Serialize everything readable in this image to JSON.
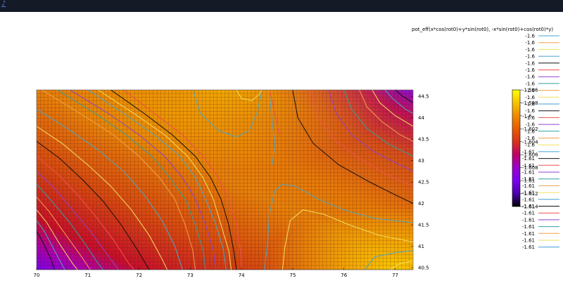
{
  "window": {
    "menu_icon": "menu-icon"
  },
  "colors": {
    "topbar": "#151a27",
    "colormap": [
      "#000000",
      "#4a00a8",
      "#7a00f0",
      "#9a00c8",
      "#c0006a",
      "#d8301a",
      "#e85c00",
      "#f08a00",
      "#f8c200",
      "#ffff00"
    ]
  },
  "chart_data": {
    "type": "heatmap",
    "title": "",
    "xlabel": "",
    "ylabel": "",
    "xlim": [
      70,
      77.35
    ],
    "ylim": [
      40.45,
      44.65
    ],
    "xticks": [
      "70",
      "71",
      "72",
      "73",
      "74",
      "75",
      "76",
      "77"
    ],
    "yticks": [
      "40.5",
      "41",
      "41.5",
      "42",
      "42.5",
      "43",
      "43.5",
      "44",
      "44.5"
    ],
    "grid": true,
    "legend_position": "top-right",
    "legend": {
      "title": "pot_eff(x*cos(rot0)+y*sin(rot0), -x*sin(rot0)+cos(rot0)*y)",
      "entries": [
        {
          "label": "-1.6",
          "color": "#4aa8c8"
        },
        {
          "label": "-1.6",
          "color": "#f0a050"
        },
        {
          "label": "-1.6",
          "color": "#f0e060"
        },
        {
          "label": "-1.6",
          "color": "#40a0d0"
        },
        {
          "label": "-1.6",
          "color": "#101010"
        },
        {
          "label": "-1.6",
          "color": "#f05050"
        },
        {
          "label": "-1.6",
          "color": "#9040d0"
        },
        {
          "label": "-1.6",
          "color": "#30a0a0"
        },
        {
          "label": "-1.6",
          "color": "#f0a050"
        },
        {
          "label": "-1.6",
          "color": "#f0e060"
        },
        {
          "label": "-1.6",
          "color": "#40a0d0"
        },
        {
          "label": "-1.6",
          "color": "#101010"
        },
        {
          "label": "-1.6",
          "color": "#f05050"
        },
        {
          "label": "-1.6",
          "color": "#9040d0"
        },
        {
          "label": "-1.6",
          "color": "#30a0a0"
        },
        {
          "label": "-1.6",
          "color": "#f0a050"
        },
        {
          "label": "-1.6",
          "color": "#f0e060"
        },
        {
          "label": "-1.61",
          "color": "#40a0d0"
        },
        {
          "label": "-1.61",
          "color": "#101010"
        },
        {
          "label": "-1.61",
          "color": "#f05050"
        },
        {
          "label": "-1.61",
          "color": "#9040d0"
        },
        {
          "label": "-1.61",
          "color": "#30a0a0"
        },
        {
          "label": "-1.61",
          "color": "#f0a050"
        },
        {
          "label": "-1.61",
          "color": "#f0e060"
        },
        {
          "label": "-1.61",
          "color": "#40a0d0"
        },
        {
          "label": "-1.61",
          "color": "#101010"
        },
        {
          "label": "-1.61",
          "color": "#f05050"
        },
        {
          "label": "-1.61",
          "color": "#9040d0"
        },
        {
          "label": "-1.61",
          "color": "#30a0a0"
        },
        {
          "label": "-1.61",
          "color": "#f0a050"
        },
        {
          "label": "-1.61",
          "color": "#f0e060"
        },
        {
          "label": "-1.61",
          "color": "#40a0d0"
        }
      ]
    },
    "colorbar": {
      "range": [
        -1.614,
        -1.596
      ],
      "labels": [
        "-1.596",
        "-1.598",
        "-1.6",
        "-1.602",
        "-1.604",
        "-1.606",
        "-1.608",
        "-1.61",
        "-1.612",
        "-1.614"
      ]
    },
    "contours": [
      {
        "color": "#4aa8c8",
        "points": [
          [
            71.0,
            44.65
          ],
          [
            71.7,
            44.1
          ],
          [
            72.3,
            43.6
          ],
          [
            72.8,
            43.1
          ],
          [
            73.1,
            42.6
          ],
          [
            73.3,
            42.1
          ],
          [
            73.5,
            41.5
          ],
          [
            73.65,
            40.9
          ],
          [
            73.7,
            40.45
          ]
        ]
      },
      {
        "color": "#f0e060",
        "points": [
          [
            71.2,
            44.65
          ],
          [
            71.9,
            44.1
          ],
          [
            72.5,
            43.6
          ],
          [
            72.95,
            43.1
          ],
          [
            73.25,
            42.6
          ],
          [
            73.45,
            42.1
          ],
          [
            73.6,
            41.5
          ],
          [
            73.75,
            40.9
          ],
          [
            73.8,
            40.45
          ]
        ]
      },
      {
        "color": "#101010",
        "points": [
          [
            71.45,
            44.65
          ],
          [
            72.1,
            44.1
          ],
          [
            72.65,
            43.6
          ],
          [
            73.1,
            43.1
          ],
          [
            73.4,
            42.6
          ],
          [
            73.6,
            42.1
          ],
          [
            73.75,
            41.5
          ],
          [
            73.85,
            40.9
          ],
          [
            73.9,
            40.45
          ]
        ]
      },
      {
        "color": "#f05050",
        "points": [
          [
            71.7,
            44.65
          ],
          [
            72.3,
            44.1
          ],
          [
            72.85,
            43.6
          ],
          [
            73.25,
            43.1
          ],
          [
            73.55,
            42.6
          ],
          [
            73.75,
            42.1
          ],
          [
            73.9,
            41.5
          ],
          [
            73.98,
            40.9
          ],
          [
            74.0,
            40.45
          ]
        ]
      },
      {
        "color": "#9040d0",
        "points": [
          [
            70.65,
            44.65
          ],
          [
            71.4,
            44.1
          ],
          [
            72.0,
            43.6
          ],
          [
            72.5,
            43.1
          ],
          [
            72.85,
            42.6
          ],
          [
            73.1,
            42.1
          ],
          [
            73.3,
            41.5
          ],
          [
            73.45,
            40.9
          ],
          [
            73.5,
            40.45
          ]
        ]
      },
      {
        "color": "#30a0a0",
        "points": [
          [
            70.4,
            44.65
          ],
          [
            71.15,
            44.1
          ],
          [
            71.75,
            43.6
          ],
          [
            72.25,
            43.1
          ],
          [
            72.6,
            42.6
          ],
          [
            72.9,
            42.1
          ],
          [
            73.1,
            41.5
          ],
          [
            73.25,
            40.9
          ],
          [
            73.3,
            40.45
          ]
        ]
      },
      {
        "color": "#f0a050",
        "points": [
          [
            70.1,
            44.65
          ],
          [
            70.85,
            44.1
          ],
          [
            71.5,
            43.6
          ],
          [
            72.0,
            43.1
          ],
          [
            72.4,
            42.6
          ],
          [
            72.7,
            42.1
          ],
          [
            72.9,
            41.5
          ],
          [
            73.05,
            40.9
          ],
          [
            73.1,
            40.45
          ]
        ]
      },
      {
        "color": "#4aa8c8",
        "points": [
          [
            70.0,
            44.2
          ],
          [
            70.6,
            43.75
          ],
          [
            71.2,
            43.25
          ],
          [
            71.7,
            42.75
          ],
          [
            72.1,
            42.2
          ],
          [
            72.45,
            41.6
          ],
          [
            72.7,
            41.0
          ],
          [
            72.85,
            40.45
          ]
        ]
      },
      {
        "color": "#f0e060",
        "points": [
          [
            70.0,
            43.8
          ],
          [
            70.5,
            43.4
          ],
          [
            71.0,
            42.9
          ],
          [
            71.45,
            42.4
          ],
          [
            71.85,
            41.85
          ],
          [
            72.2,
            41.25
          ],
          [
            72.45,
            40.7
          ],
          [
            72.55,
            40.45
          ]
        ]
      },
      {
        "color": "#101010",
        "points": [
          [
            70.0,
            43.45
          ],
          [
            70.45,
            43.05
          ],
          [
            70.9,
            42.55
          ],
          [
            71.3,
            42.05
          ],
          [
            71.65,
            41.5
          ],
          [
            71.95,
            40.95
          ],
          [
            72.2,
            40.45
          ]
        ]
      },
      {
        "color": "#f05050",
        "points": [
          [
            70.0,
            43.1
          ],
          [
            70.4,
            42.7
          ],
          [
            70.8,
            42.2
          ],
          [
            71.15,
            41.7
          ],
          [
            71.5,
            41.15
          ],
          [
            71.8,
            40.6
          ],
          [
            71.9,
            40.45
          ]
        ]
      },
      {
        "color": "#9040d0",
        "points": [
          [
            70.0,
            42.75
          ],
          [
            70.35,
            42.35
          ],
          [
            70.7,
            41.85
          ],
          [
            71.05,
            41.35
          ],
          [
            71.35,
            40.85
          ],
          [
            71.6,
            40.45
          ]
        ]
      },
      {
        "color": "#30a0a0",
        "points": [
          [
            70.0,
            42.45
          ],
          [
            70.3,
            42.05
          ],
          [
            70.65,
            41.55
          ],
          [
            70.95,
            41.05
          ],
          [
            71.2,
            40.6
          ],
          [
            71.3,
            40.45
          ]
        ]
      },
      {
        "color": "#f0a050",
        "points": [
          [
            70.0,
            42.15
          ],
          [
            70.25,
            41.8
          ],
          [
            70.55,
            41.3
          ],
          [
            70.85,
            40.8
          ],
          [
            71.05,
            40.45
          ]
        ]
      },
      {
        "color": "#f0e060",
        "points": [
          [
            70.0,
            41.85
          ],
          [
            70.2,
            41.55
          ],
          [
            70.45,
            41.05
          ],
          [
            70.7,
            40.6
          ],
          [
            70.8,
            40.45
          ]
        ]
      },
      {
        "color": "#4aa8c8",
        "points": [
          [
            70.0,
            41.6
          ],
          [
            70.15,
            41.35
          ],
          [
            70.35,
            40.9
          ],
          [
            70.55,
            40.45
          ]
        ]
      },
      {
        "color": "#101010",
        "points": [
          [
            70.0,
            41.35
          ],
          [
            70.12,
            41.1
          ],
          [
            70.28,
            40.7
          ],
          [
            70.35,
            40.45
          ]
        ]
      },
      {
        "color": "#4aa8c8",
        "points": [
          [
            73.05,
            44.65
          ],
          [
            73.2,
            44.1
          ],
          [
            73.55,
            43.7
          ],
          [
            73.9,
            43.55
          ],
          [
            74.15,
            43.7
          ],
          [
            74.3,
            44.1
          ],
          [
            74.4,
            44.65
          ]
        ]
      },
      {
        "color": "#f0e060",
        "points": [
          [
            73.9,
            44.65
          ],
          [
            74.0,
            44.45
          ],
          [
            74.2,
            44.4
          ],
          [
            74.35,
            44.55
          ],
          [
            74.4,
            44.65
          ]
        ]
      },
      {
        "color": "#f05050",
        "points": [
          [
            74.55,
            44.65
          ],
          [
            74.65,
            44.1
          ],
          [
            74.75,
            43.55
          ]
        ]
      },
      {
        "color": "#4aa8c8",
        "points": [
          [
            74.45,
            40.45
          ],
          [
            74.5,
            41.0
          ],
          [
            74.55,
            41.8
          ],
          [
            74.65,
            42.3
          ],
          [
            74.8,
            42.45
          ],
          [
            75.05,
            42.4
          ],
          [
            75.5,
            42.1
          ],
          [
            76.0,
            41.85
          ],
          [
            76.6,
            41.65
          ],
          [
            77.35,
            41.55
          ]
        ]
      },
      {
        "color": "#f0e060",
        "points": [
          [
            74.8,
            40.45
          ],
          [
            74.85,
            41.0
          ],
          [
            74.95,
            41.6
          ],
          [
            75.2,
            41.85
          ],
          [
            75.6,
            41.75
          ],
          [
            76.1,
            41.5
          ],
          [
            76.7,
            41.25
          ],
          [
            77.35,
            41.1
          ]
        ]
      },
      {
        "color": "#4aa8c8",
        "points": [
          [
            76.4,
            40.45
          ],
          [
            76.6,
            40.75
          ],
          [
            77.0,
            40.85
          ],
          [
            77.35,
            40.9
          ]
        ]
      },
      {
        "color": "#f0e060",
        "points": [
          [
            76.9,
            40.45
          ],
          [
            77.1,
            40.6
          ],
          [
            77.35,
            40.65
          ]
        ]
      },
      {
        "color": "#4aa8c8",
        "points": [
          [
            74.55,
            44.5
          ],
          [
            74.6,
            43.9
          ],
          [
            74.65,
            43.4
          ],
          [
            74.6,
            42.9
          ]
        ]
      },
      {
        "color": "#101010",
        "points": [
          [
            75.0,
            44.65
          ],
          [
            75.1,
            44.0
          ],
          [
            75.4,
            43.4
          ],
          [
            75.9,
            42.9
          ],
          [
            76.5,
            42.5
          ],
          [
            77.0,
            42.2
          ],
          [
            77.35,
            42.0
          ]
        ]
      },
      {
        "color": "#f05050",
        "points": [
          [
            75.35,
            44.65
          ],
          [
            75.5,
            44.0
          ],
          [
            75.85,
            43.45
          ],
          [
            76.3,
            43.05
          ],
          [
            76.8,
            42.7
          ],
          [
            77.35,
            42.4
          ]
        ]
      },
      {
        "color": "#9040d0",
        "points": [
          [
            75.7,
            44.65
          ],
          [
            75.85,
            44.1
          ],
          [
            76.15,
            43.6
          ],
          [
            76.6,
            43.2
          ],
          [
            77.0,
            42.95
          ],
          [
            77.35,
            42.75
          ]
        ]
      },
      {
        "color": "#30a0a0",
        "points": [
          [
            76.0,
            44.65
          ],
          [
            76.15,
            44.2
          ],
          [
            76.45,
            43.75
          ],
          [
            76.85,
            43.4
          ],
          [
            77.35,
            43.1
          ]
        ]
      },
      {
        "color": "#f0a050",
        "points": [
          [
            76.3,
            44.65
          ],
          [
            76.45,
            44.25
          ],
          [
            76.75,
            43.9
          ],
          [
            77.1,
            43.6
          ],
          [
            77.35,
            43.45
          ]
        ]
      },
      {
        "color": "#f0e060",
        "points": [
          [
            76.55,
            44.65
          ],
          [
            76.7,
            44.35
          ],
          [
            77.0,
            44.05
          ],
          [
            77.35,
            43.8
          ]
        ]
      },
      {
        "color": "#4aa8c8",
        "points": [
          [
            76.8,
            44.65
          ],
          [
            76.95,
            44.45
          ],
          [
            77.2,
            44.2
          ],
          [
            77.35,
            44.1
          ]
        ]
      },
      {
        "color": "#101010",
        "points": [
          [
            77.0,
            44.65
          ],
          [
            77.15,
            44.5
          ],
          [
            77.35,
            44.35
          ]
        ]
      }
    ]
  }
}
